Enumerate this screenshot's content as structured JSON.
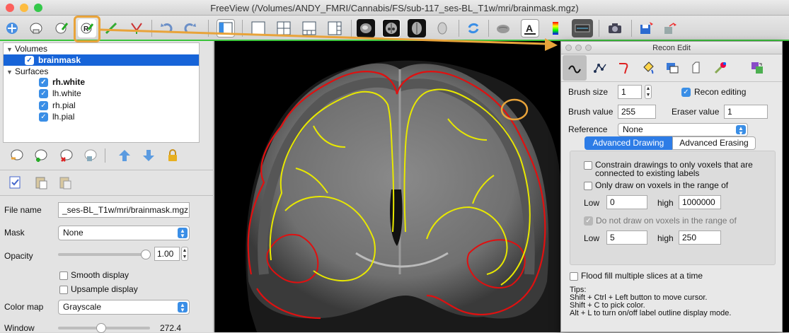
{
  "window": {
    "title": "FreeView (/Volumes/ANDY_FMRI/Cannabis/FS/sub-117_ses-BL_T1w/mri/brainmask.mgz)"
  },
  "toolbar": {
    "icons": [
      "navigate-icon",
      "voxel-edit-icon",
      "recon-edit-icon",
      "roi-edit-icon",
      "point-set-edit-icon",
      "contour-icon",
      "undo-icon",
      "redo-icon",
      "toggle-panel-icon",
      "layout-1x1-icon",
      "layout-2x2-icon",
      "layout-1-3-icon",
      "layout-1-3h-icon",
      "sagittal-view-icon",
      "coronal-view-icon",
      "axial-view-icon",
      "3d-view-icon",
      "reset-view-icon",
      "toggle-surface-icon",
      "toggle-annotation-icon",
      "color-bar-icon",
      "coordinate-icon",
      "snapshot-icon",
      "save-icon",
      "save-as-icon"
    ]
  },
  "layers": {
    "volumes_label": "Volumes",
    "volumes": [
      {
        "name": "brainmask",
        "checked": true
      }
    ],
    "surfaces_label": "Surfaces",
    "surfaces": [
      {
        "name": "rh.white",
        "checked": true
      },
      {
        "name": "lh.white",
        "checked": true
      },
      {
        "name": "rh.pial",
        "checked": true
      },
      {
        "name": "lh.pial",
        "checked": true
      }
    ]
  },
  "properties": {
    "file_name_label": "File name",
    "file_name_value": "_ses-BL_T1w/mri/brainmask.mgz",
    "mask_label": "Mask",
    "mask_value": "None",
    "opacity_label": "Opacity",
    "opacity_value": "1.00",
    "opacity_fraction": 0.95,
    "smooth_label": "Smooth display",
    "upsample_label": "Upsample display",
    "colormap_label": "Color map",
    "colormap_value": "Grayscale",
    "window_label": "Window",
    "window_value": "272.4"
  },
  "recon_edit": {
    "title": "Recon Edit",
    "tabs": [
      "freehand-icon",
      "polyline-icon",
      "livewire-icon",
      "fill-icon",
      "contour-icon",
      "color-picker-icon",
      "clone-icon",
      "replace-icon"
    ],
    "brush_size_label": "Brush size",
    "brush_size_value": "1",
    "recon_editing_label": "Recon editing",
    "brush_value_label": "Brush value",
    "brush_value": "255",
    "eraser_value_label": "Eraser value",
    "eraser_value": "1",
    "reference_label": "Reference",
    "reference_value": "None",
    "tab_adv_drawing": "Advanced Drawing",
    "tab_adv_erasing": "Advanced Erasing",
    "constrain_label_1": "Constrain drawings to only voxels that are",
    "constrain_label_2": "connected to existing labels",
    "only_draw_label": "Only draw on voxels in the range of",
    "low_label": "Low",
    "high_label": "high",
    "range1_low": "0",
    "range1_high": "1000000",
    "do_not_draw_label": "Do not draw on voxels in the range of",
    "range2_low": "5",
    "range2_high": "250",
    "flood_fill_label": "Flood fill multiple slices at a time",
    "tips_title": "Tips:",
    "tip1": "Shift + Ctrl + Left button to move cursor.",
    "tip2": "Shift + C to pick color.",
    "tip3": "Alt + L to turn on/off label outline display mode."
  },
  "colors": {
    "accent": "#3a8ee6",
    "highlight": "#e8a33a",
    "white_surface": "#e8e800",
    "pial_surface": "#e01010",
    "toolbar_border": "#3cc43c"
  }
}
